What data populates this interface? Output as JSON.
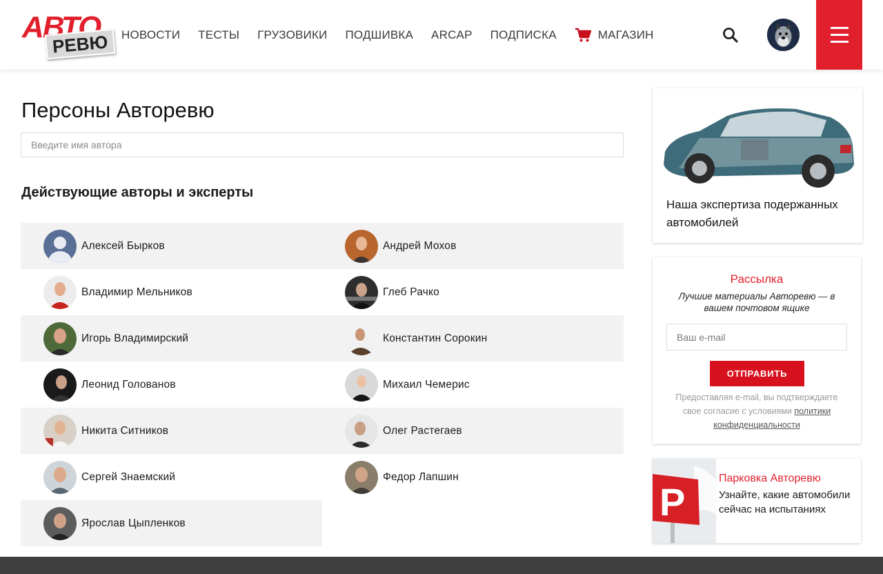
{
  "header": {
    "logo_top": "АВТО",
    "logo_bottom": "РЕВЮ",
    "nav": [
      "НОВОСТИ",
      "ТЕСТЫ",
      "ГРУЗОВИКИ",
      "ПОДШИВКА",
      "ARCAP",
      "ПОДПИСКА",
      "МАГАЗИН"
    ],
    "icons": {
      "search": "search-icon",
      "cart": "cart-icon",
      "menu": "menu-icon",
      "avatar": "user-avatar"
    },
    "accent": "#e2202d"
  },
  "main": {
    "title": "Персоны Авторевю",
    "search_placeholder": "Введите имя автора",
    "section_title": "Действующие авторы и эксперты",
    "authors": [
      [
        "Алексей Бырков",
        "Андрей Мохов"
      ],
      [
        "Владимир Мельников",
        "Глеб Рачко"
      ],
      [
        "Игорь Владимирский",
        "Константин Сорокин"
      ],
      [
        "Леонид Голованов",
        "Михаил Чемерис"
      ],
      [
        "Никита Ситников",
        "Олег Растегаев"
      ],
      [
        "Сергей Знаемский",
        "Федор Лапшин"
      ],
      [
        "Ярослав Цыпленков"
      ]
    ]
  },
  "sidebar": {
    "expertise_caption": "Наша экспертиза подержанных автомобилей",
    "newsletter": {
      "title": "Рассылка",
      "subtitle": "Лучшие материалы Авторевю — в вашем почтовом ящике",
      "email_placeholder": "Ваш e-mail",
      "button": "ОТПРАВИТЬ",
      "consent_text": "Предоставляя e-mail, вы подтверждаете свое согласие с условиями ",
      "consent_link": "политики конфиденциальности"
    },
    "parking": {
      "title": "Парковка Авторевю",
      "text": "Узнайте, какие автомобили сейчас на испытаниях"
    }
  }
}
